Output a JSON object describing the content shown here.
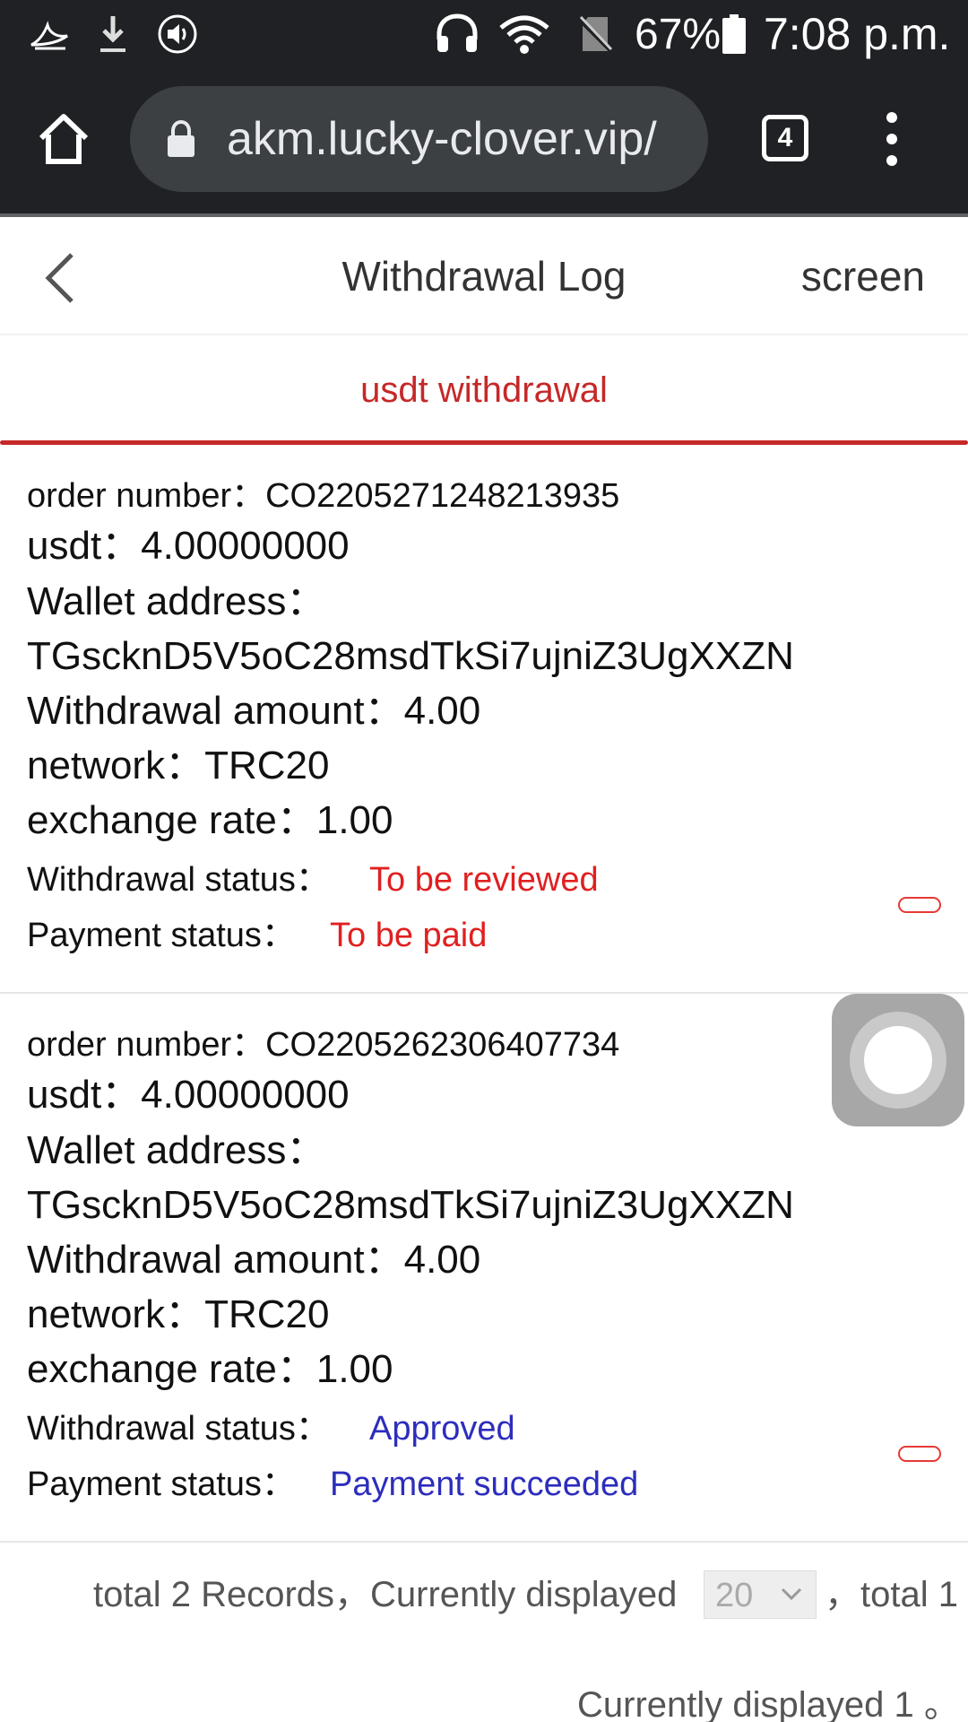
{
  "status_bar": {
    "battery": "67%",
    "time": "7:08 p.m.",
    "icons": [
      "feather-icon",
      "download-icon",
      "volume-icon",
      "headset-icon",
      "wifi-icon",
      "no-sim-icon",
      "battery-icon"
    ]
  },
  "browser": {
    "url": "akm.lucky-clover.vip/",
    "tab_count": "4"
  },
  "header": {
    "title": "Withdrawal Log",
    "screen_label": "screen"
  },
  "tab": {
    "label": "usdt withdrawal"
  },
  "records": [
    {
      "order_number": "order number：CO2205271248213935",
      "usdt": "usdt：4.00000000",
      "wallet_label": "Wallet address：",
      "wallet_address": "TGscknD5V5oC28msdTkSi7ujniZ3UgXXZN",
      "withdrawal_amount": "Withdrawal amount：4.00",
      "network": "network：TRC20",
      "exchange_rate": "exchange rate：1.00",
      "withdrawal_status_label": "Withdrawal status：",
      "withdrawal_status": "To be reviewed",
      "payment_status_label": "Payment status：",
      "payment_status": "To be paid",
      "status_color": "#e02020"
    },
    {
      "order_number": "order number：CO2205262306407734",
      "usdt": "usdt：4.00000000",
      "wallet_label": "Wallet address：",
      "wallet_address": "TGscknD5V5oC28msdTkSi7ujniZ3UgXXZN",
      "withdrawal_amount": "Withdrawal amount：4.00",
      "network": "network：TRC20",
      "exchange_rate": "exchange rate：1.00",
      "withdrawal_status_label": "Withdrawal status：",
      "withdrawal_status": "Approved",
      "payment_status_label": "Payment status：",
      "payment_status": "Payment succeeded",
      "status_color": "#2d2dbd"
    }
  ],
  "footer": {
    "total_records": "total 2 Records，Currently displayed",
    "page_size": "20",
    "total_pages": "，total 1",
    "current_page": "Currently displayed 1 。"
  }
}
